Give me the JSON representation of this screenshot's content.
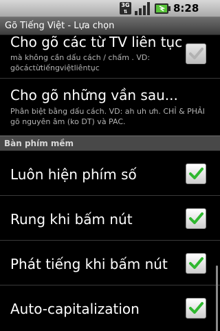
{
  "status_bar": {
    "network_label": "3G",
    "time": "8:28 PM",
    "icons": [
      "3g-icon",
      "signal-icon",
      "battery-charging-icon"
    ]
  },
  "title_bar": {
    "title": "Gõ Tiếng Việt - Lựa chọn"
  },
  "preferences": [
    {
      "title": "Cho gõ các từ TV liên tục",
      "summary": "mà không cần dấu cách / chấm . VD: gõcáctừtiếngviệtliêntục",
      "checked": true,
      "enabled": false
    },
    {
      "title": "Cho gõ những vần sau...",
      "summary": "Phân biệt bằng dấu cách. VD: ah uh ưh. CHỈ & PHẢI gõ nguyên âm (ko DT) và PAC."
    }
  ],
  "category": {
    "label": "Bàn phím mềm"
  },
  "keyboard_prefs": [
    {
      "title": "Luôn hiện phím số",
      "checked": true
    },
    {
      "title": "Rung khi bấm nút",
      "checked": true
    },
    {
      "title": "Phát tiếng khi bấm nút",
      "checked": true
    },
    {
      "title": "Auto-capitalization",
      "checked": true
    }
  ],
  "colors": {
    "check_green": "#2fb82f",
    "background": "#000000",
    "category_bg": "#484848"
  }
}
